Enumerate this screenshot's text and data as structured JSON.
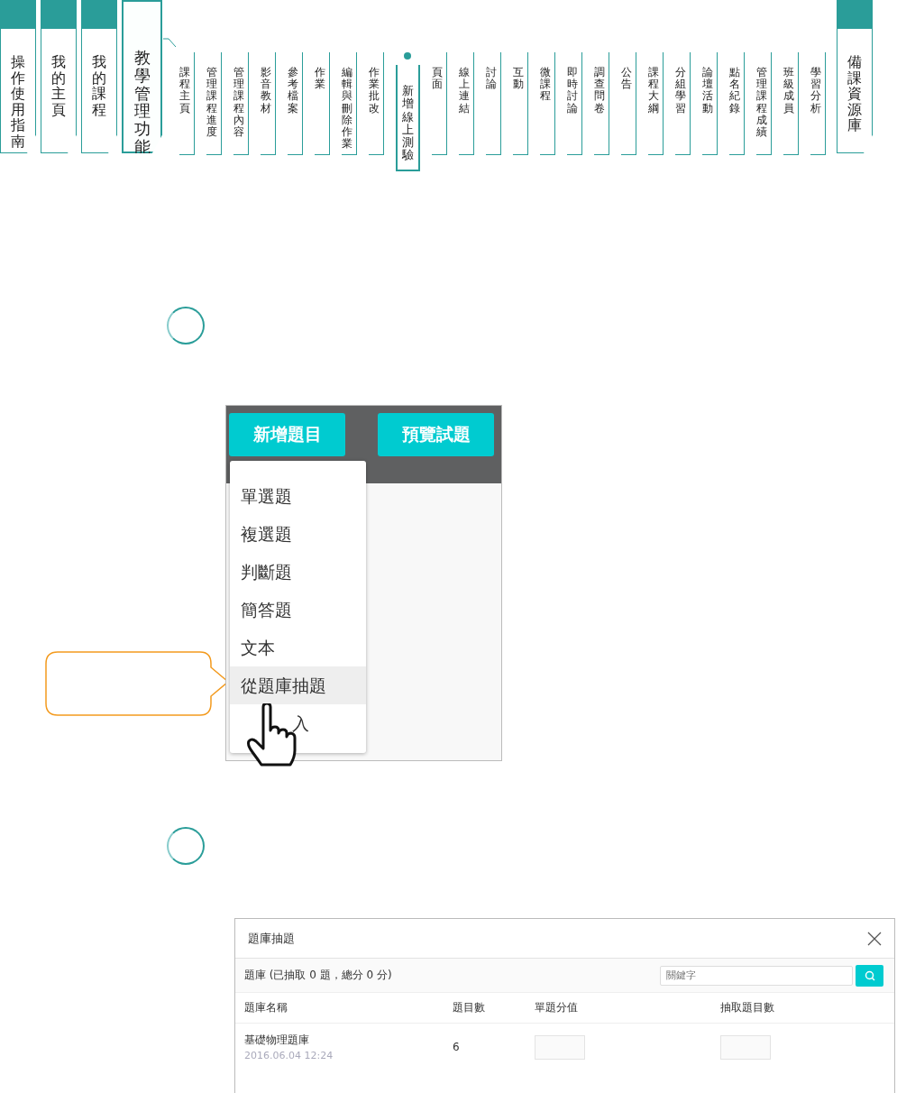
{
  "main_tabs": [
    {
      "label": "操作使用指南",
      "selected": false
    },
    {
      "label": "我的主頁",
      "selected": false
    },
    {
      "label": "我的課程",
      "selected": false
    },
    {
      "label": "教學管理功能",
      "selected": true
    }
  ],
  "sub_menu": [
    {
      "label": "課程主頁",
      "selected": false
    },
    {
      "label": "管理課程進度",
      "selected": false
    },
    {
      "label": "管理課程內容",
      "selected": false
    },
    {
      "label": "影音教材",
      "selected": false
    },
    {
      "label": "參考檔案",
      "selected": false
    },
    {
      "label": "作業",
      "selected": false
    },
    {
      "label": "編輯與刪除作業",
      "selected": false
    },
    {
      "label": "作業批改",
      "selected": false
    },
    {
      "label": "新增線上測驗",
      "selected": true
    },
    {
      "label": "頁面",
      "selected": false
    },
    {
      "label": "線上連結",
      "selected": false
    },
    {
      "label": "討論",
      "selected": false
    },
    {
      "label": "互動",
      "selected": false
    },
    {
      "label": "微課程",
      "selected": false
    },
    {
      "label": "即時討論",
      "selected": false
    },
    {
      "label": "調查問卷",
      "selected": false
    },
    {
      "label": "公告",
      "selected": false
    },
    {
      "label": "課程大綱",
      "selected": false
    },
    {
      "label": "分組學習",
      "selected": false
    },
    {
      "label": "論壇活動",
      "selected": false
    },
    {
      "label": "點名紀錄",
      "selected": false
    },
    {
      "label": "管理課程成績",
      "selected": false
    },
    {
      "label": "班級成員",
      "selected": false
    },
    {
      "label": "學習分析",
      "selected": false
    }
  ],
  "right_tab": {
    "label": "備課資源庫",
    "selected": false
  },
  "editor": {
    "buttons": [
      "新增題目",
      "預覽試題"
    ],
    "menu": [
      {
        "kind": "option",
        "label": "單選題",
        "selected": false
      },
      {
        "kind": "option",
        "label": "複選題",
        "selected": false
      },
      {
        "kind": "option",
        "label": "判斷題",
        "selected": false
      },
      {
        "kind": "option",
        "label": "簡答題",
        "selected": false
      },
      {
        "kind": "option",
        "label": "文本",
        "selected": false
      },
      {
        "kind": "option",
        "label": "從題庫抽題",
        "selected": true
      },
      {
        "kind": "covered",
        "label": "入",
        "selected": false
      }
    ]
  },
  "dialog": {
    "title": "題庫抽題",
    "summary": "題庫 (已抽取 0 題，總分 0 分)",
    "search": {
      "placeholder": "關鍵字"
    },
    "columns": [
      "題庫名稱",
      "題目數",
      "單題分值",
      "抽取題目數"
    ],
    "rows": [
      {
        "name": "基礎物理題庫",
        "date": "2016.06.04 12:24",
        "count": "6"
      }
    ]
  }
}
